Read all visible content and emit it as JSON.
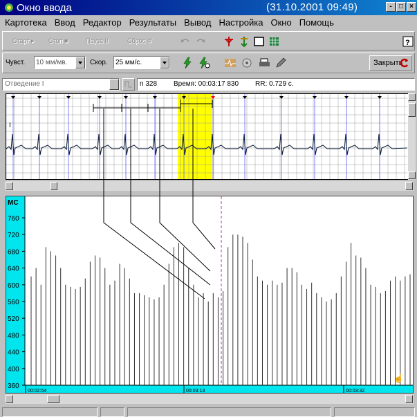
{
  "window": {
    "title": "Окно ввода",
    "timestamp": "(31.10.2001  09:49)",
    "controls": [
      "-",
      "□",
      "×"
    ]
  },
  "menu": [
    "Картотека",
    "Ввод",
    "Редактор",
    "Результаты",
    "Вывод",
    "Настройка",
    "Окно",
    "Помощь"
  ],
  "toolbar": {
    "start": "Старт ▸",
    "stop": "Стоп ■",
    "pause": "Пауза II",
    "reset": "Сброс ↺",
    "undo_icon": "undo-icon",
    "redo_icon": "redo-icon",
    "help_icon": "help-icon"
  },
  "settings": {
    "sensitivity_label": "Чувст.",
    "sensitivity_value": "10 мм/мв.",
    "speed_label": "Скор.",
    "speed_value": "25 мм/с.",
    "close_label": "Закрыть"
  },
  "info": {
    "lead": "Отведение I",
    "n": "n 328",
    "time": "Время: 00:03:17 830",
    "rr": "RR: 0.729 с."
  },
  "ecg": {
    "lead_mark": "I",
    "highlight_color": "#ffff00"
  },
  "rr_chart": {
    "unit_label": "МС",
    "y_ticks": [
      "760",
      "720",
      "680",
      "640",
      "600",
      "560",
      "520",
      "480",
      "440",
      "400",
      "360"
    ],
    "time_labels": [
      "00:02:54",
      "00:03:13",
      "00:03:32"
    ],
    "axis_bar_color": "#00e5ee",
    "marker_color": "#c050c0"
  },
  "chart_data": {
    "type": "bar",
    "xlabel": "",
    "ylabel": "МС",
    "ylim": [
      360,
      780
    ],
    "x_ticks": [
      "00:02:54",
      "00:03:13",
      "00:03:32"
    ],
    "values": [
      620,
      640,
      600,
      690,
      680,
      670,
      640,
      600,
      595,
      590,
      595,
      615,
      655,
      670,
      665,
      640,
      600,
      610,
      650,
      640,
      615,
      580,
      580,
      575,
      570,
      565,
      570,
      600,
      650,
      690,
      700,
      690,
      640,
      600,
      570,
      580,
      560,
      580,
      570,
      585,
      690,
      720,
      720,
      715,
      700,
      660,
      620,
      610,
      600,
      610,
      600,
      605,
      640,
      640,
      630,
      600,
      590,
      605,
      580,
      570,
      560,
      565,
      580,
      620,
      655,
      700,
      670,
      665,
      640,
      600,
      595,
      580,
      585,
      610,
      620,
      610,
      620,
      625
    ]
  }
}
